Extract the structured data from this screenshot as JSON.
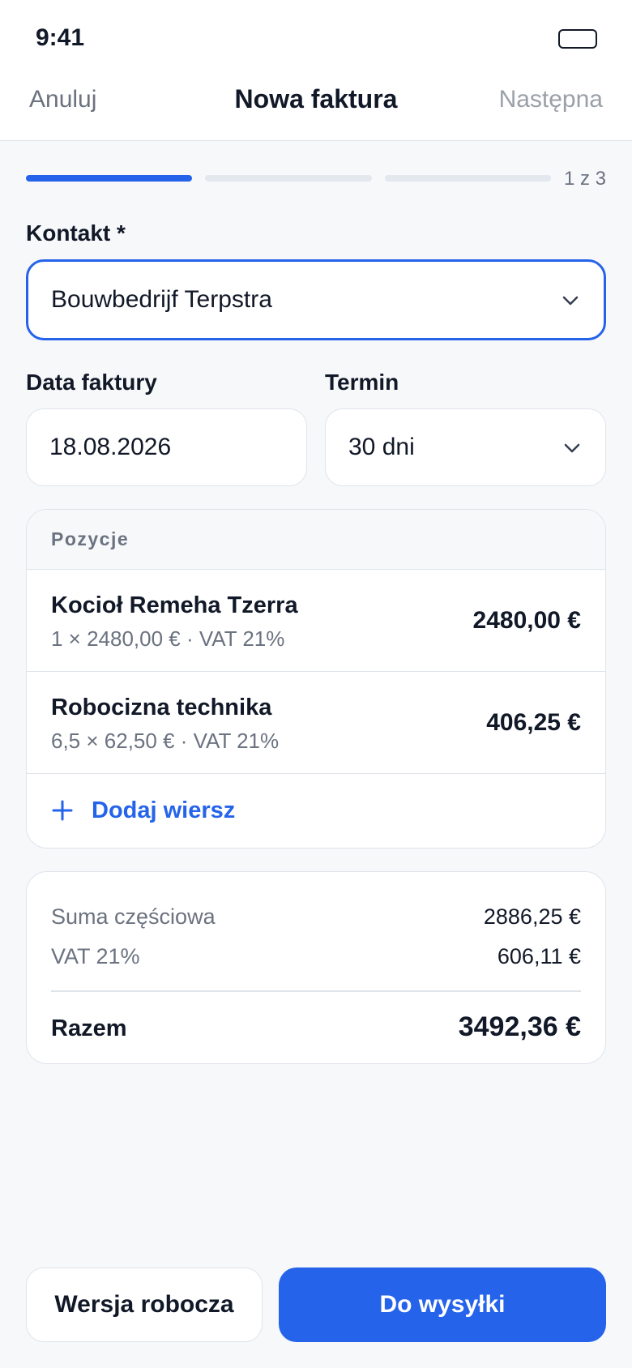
{
  "status_bar": {
    "time": "9:41"
  },
  "nav": {
    "cancel": "Anuluj",
    "title": "Nowa faktura",
    "next": "Następna"
  },
  "progress": {
    "current": 1,
    "total": 3,
    "label": "1 z 3"
  },
  "contact": {
    "label": "Kontakt *",
    "value": "Bouwbedrijf Terpstra"
  },
  "invoice_date": {
    "label": "Data faktury",
    "value": "18.08.2026"
  },
  "term": {
    "label": "Termin",
    "value": "30 dni"
  },
  "items": {
    "header": "Pozycje",
    "rows": [
      {
        "name": "Kocioł Remeha Tzerra",
        "meta": "1 × 2480,00 € · VAT 21%",
        "amount": "2480,00 €"
      },
      {
        "name": "Robocizna technika",
        "meta": "6,5 × 62,50 € · VAT 21%",
        "amount": "406,25 €"
      }
    ],
    "add_label": "Dodaj wiersz"
  },
  "totals": {
    "subtotal_label": "Suma częściowa",
    "subtotal": "2886,25 €",
    "vat_label": "VAT 21%",
    "vat": "606,11 €",
    "total_label": "Razem",
    "total": "3492,36 €"
  },
  "actions": {
    "draft": "Wersja robocza",
    "send": "Do wysyłki"
  },
  "colors": {
    "accent": "#2563eb",
    "text": "#111827",
    "muted": "#6b7280",
    "border": "#dfe3ea"
  },
  "icons": {
    "dropdown": "chevron-down-icon",
    "add": "plus-icon",
    "battery": "battery-icon"
  }
}
